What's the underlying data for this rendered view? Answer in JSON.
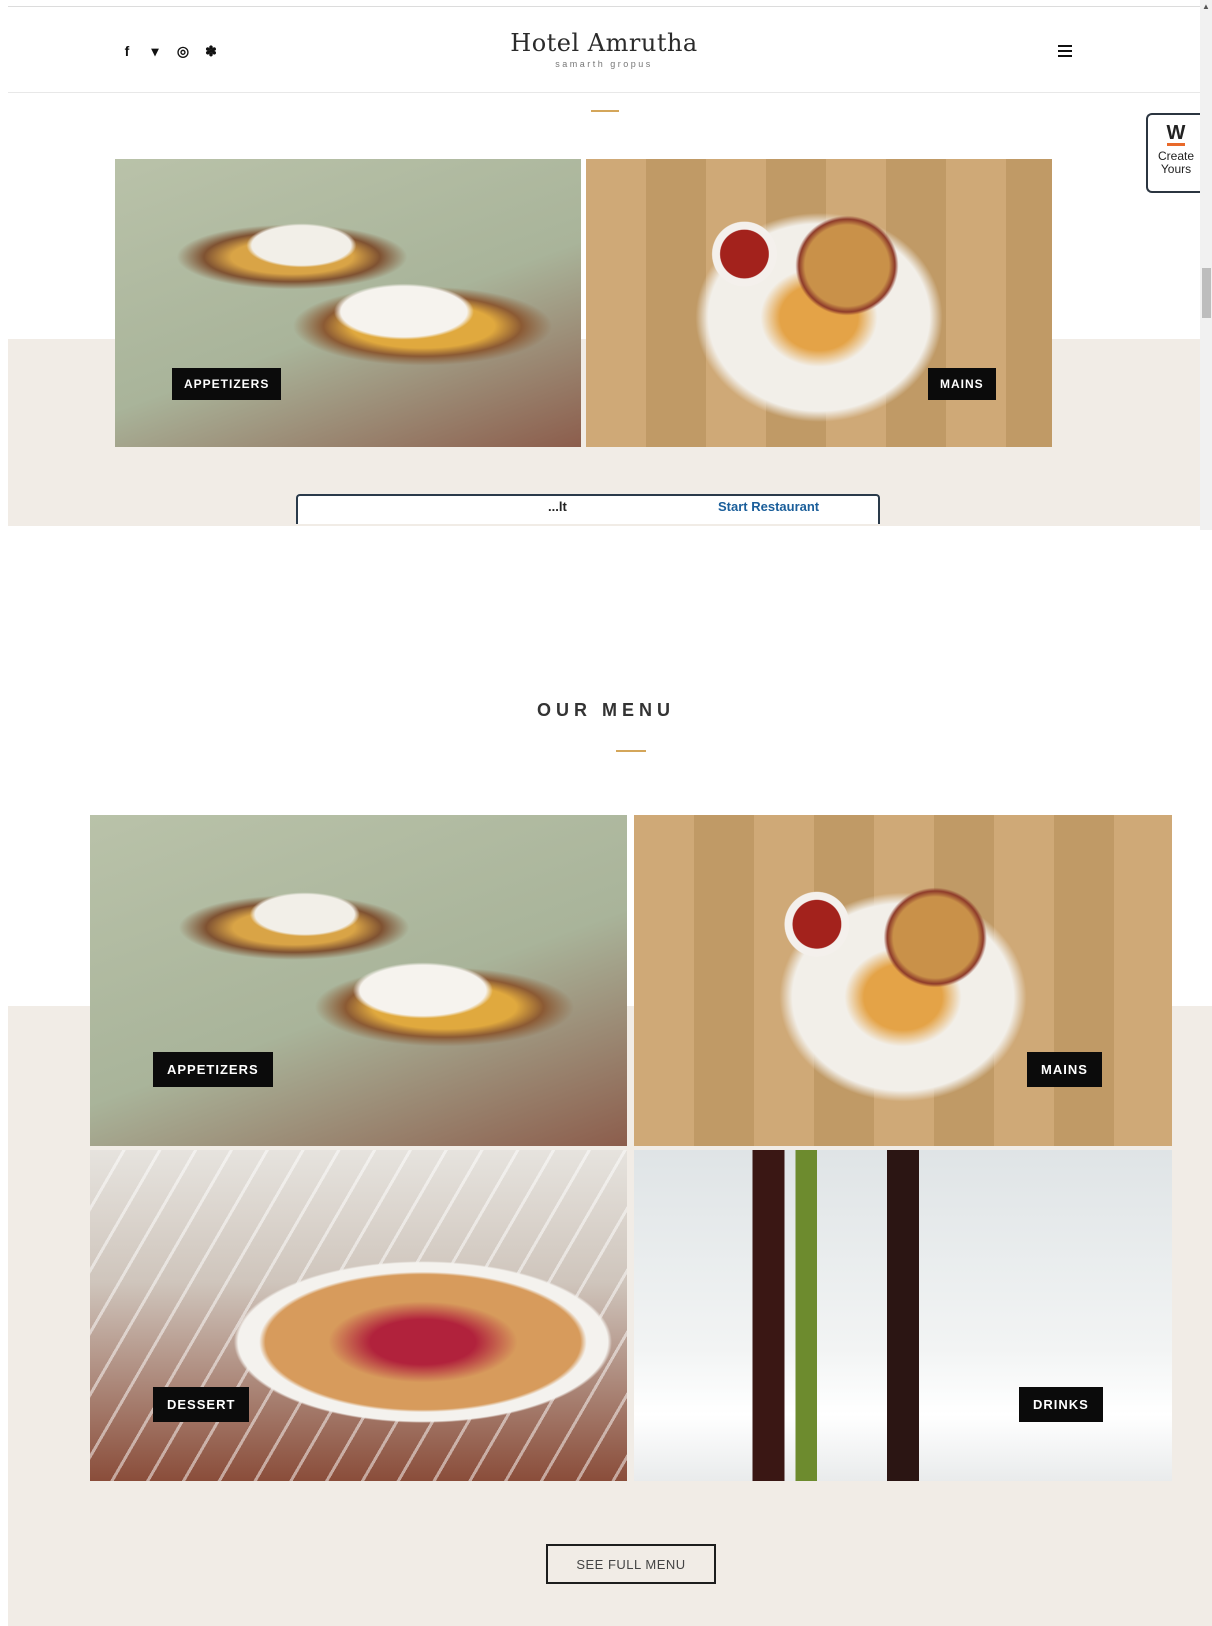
{
  "header": {
    "social_icons": [
      "facebook-icon",
      "twitter-icon",
      "instagram-icon",
      "yelp-icon"
    ],
    "social_glyphs": [
      "f",
      "🐦",
      "◎",
      "✽"
    ],
    "title": "Hotel Amrutha",
    "subtitle": "samarth gropus",
    "menu_icon": "hamburger-icon"
  },
  "top_preview": {
    "tiles": [
      {
        "label": "APPETIZERS"
      },
      {
        "label": "MAINS"
      }
    ],
    "widget": {
      "left_text": "...lt",
      "right_text": "Start Restaurant"
    }
  },
  "create_widget": {
    "logo": "W",
    "line1": "Create",
    "line2": "Yours"
  },
  "menu": {
    "heading": "OUR MENU",
    "tiles": [
      {
        "label": "APPETIZERS"
      },
      {
        "label": "MAINS"
      },
      {
        "label": "DESSERT"
      },
      {
        "label": "DRINKS"
      }
    ],
    "full_menu_button": "SEE FULL MENU"
  },
  "colors": {
    "accent": "#d4a65a",
    "band_bg": "#f1ece6",
    "label_bg": "#0b0b0b",
    "widget_orange": "#e8692a"
  }
}
